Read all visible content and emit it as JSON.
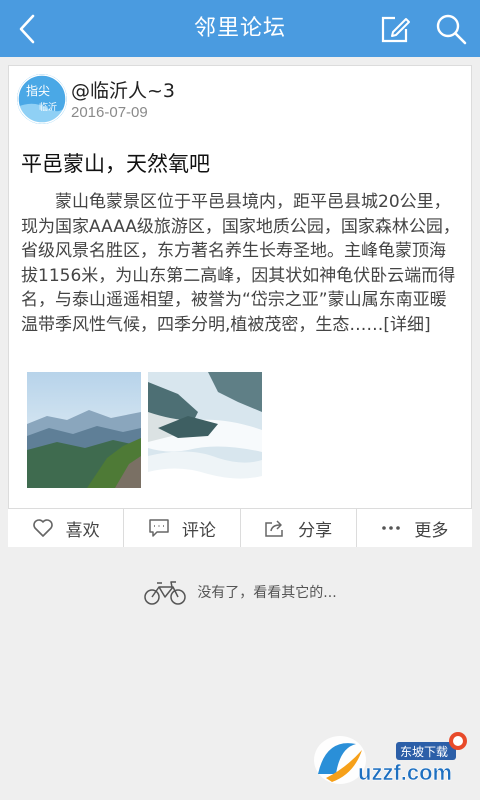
{
  "header": {
    "title": "邻里论坛",
    "back_icon": "chevron-left-icon",
    "edit_icon": "edit-icon",
    "search_icon": "search-icon",
    "bg_color": "#4a9be0"
  },
  "post": {
    "avatar_text_top": "指尖",
    "avatar_text_bottom": "临沂",
    "author": "@临沂人~3",
    "date": "2016-07-09",
    "title": "平邑蒙山，天然氧吧",
    "body": "蒙山龟蒙景区位于平邑县境内，距平邑县城20公里，现为国家AAAA级旅游区，国家地质公园，国家森林公园，省级风景名胜区，东方著名养生长寿圣地。主峰龟蒙顶海拔1156米，为山东第二高峰，因其状如神龟伏卧云端而得名，与泰山遥遥相望，被誉为“岱宗之亚”蒙山属东南亚暖温带季风性气候，四季分明,植被茂密，生态……[详细]",
    "images": [
      "mountain-landscape-photo",
      "sea-of-clouds-photo"
    ]
  },
  "actions": [
    {
      "label": "喜欢",
      "icon": "heart-icon"
    },
    {
      "label": "评论",
      "icon": "comment-icon"
    },
    {
      "label": "分享",
      "icon": "share-icon"
    },
    {
      "label": "更多",
      "icon": "more-icon"
    }
  ],
  "footer": {
    "end_text": "没有了，看看其它的...",
    "end_icon": "bicycle-icon"
  },
  "watermark": {
    "badge": "东坡下载",
    "logo_text": "uzzf.com"
  }
}
